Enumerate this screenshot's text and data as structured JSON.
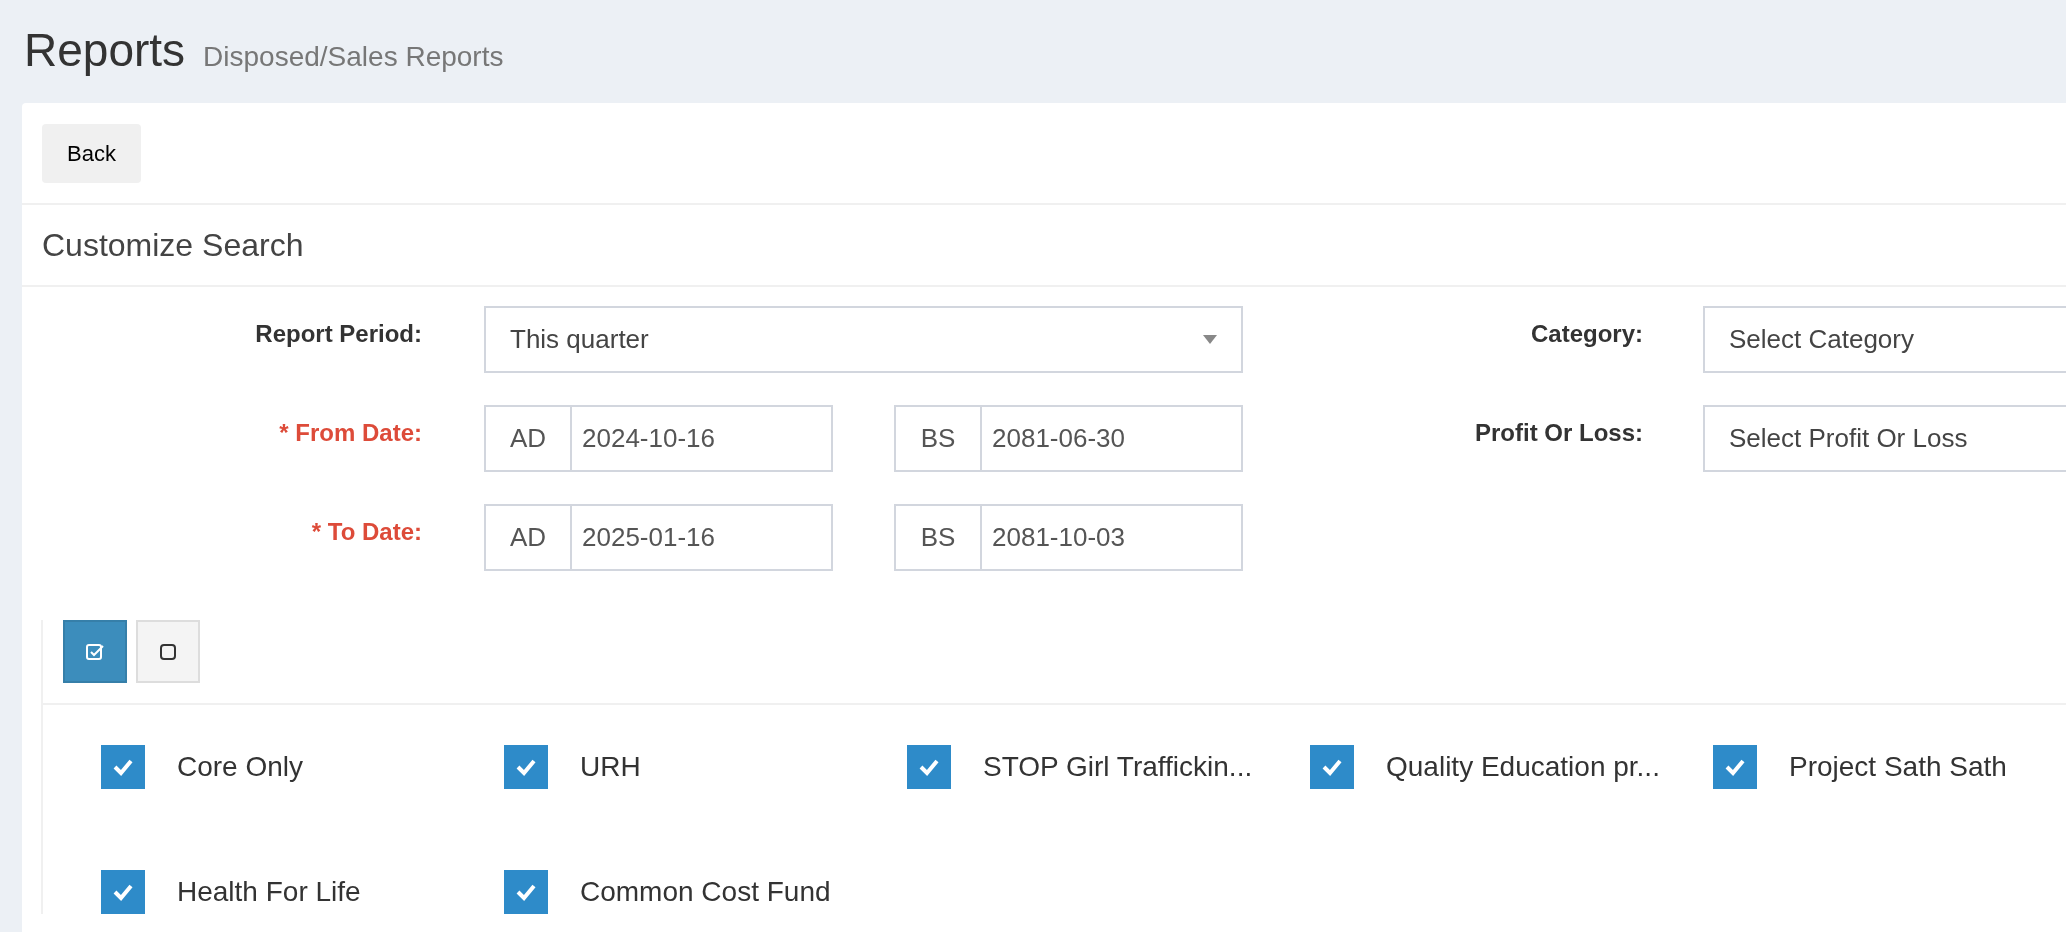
{
  "header": {
    "title": "Reports",
    "subtitle": "Disposed/Sales Reports"
  },
  "back_button": "Back",
  "section_title": "Customize Search",
  "report_period": {
    "label": "Report Period:",
    "value": "This quarter"
  },
  "from_date": {
    "label": "* From Date:",
    "required": true,
    "ad_label": "AD",
    "ad_value": "2024-10-16",
    "bs_label": "BS",
    "bs_value": "2081-06-30"
  },
  "to_date": {
    "label": "* To Date:",
    "required": true,
    "ad_label": "AD",
    "ad_value": "2025-01-16",
    "bs_label": "BS",
    "bs_value": "2081-10-03"
  },
  "category": {
    "label": "Category:",
    "value": "Select Category"
  },
  "profit_or_loss": {
    "label": "Profit Or Loss:",
    "value": "Select Profit Or Loss"
  },
  "toolbar": [
    {
      "kind": "check_all",
      "selected": true
    },
    {
      "kind": "uncheck_all",
      "selected": false
    }
  ],
  "funds": [
    {
      "label": "Core Only",
      "checked": true
    },
    {
      "label": "URH",
      "checked": true
    },
    {
      "label": "STOP Girl Traffickin...",
      "checked": true
    },
    {
      "label": "Quality Education pr...",
      "checked": true
    },
    {
      "label": "Project Sath Sath",
      "checked": true
    },
    {
      "label": "Health For Life",
      "checked": true
    },
    {
      "label": "Common Cost Fund",
      "checked": true
    }
  ]
}
